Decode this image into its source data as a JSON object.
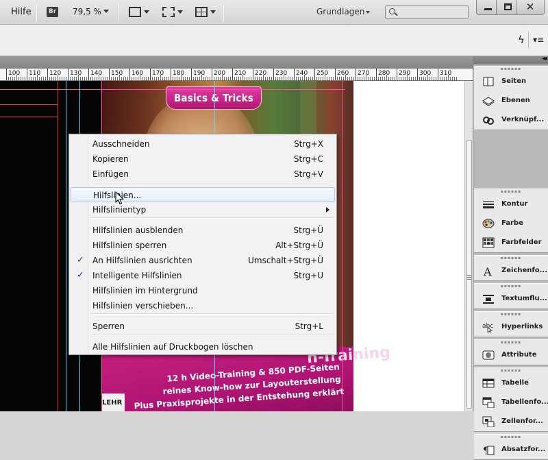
{
  "appbar": {
    "help_menu": "Hilfe",
    "bridge_badge": "Br",
    "zoom_level": "79,5 %",
    "workspace": "Grundlagen",
    "search_placeholder": ""
  },
  "ruler": {
    "labels": [
      "100",
      "110",
      "120",
      "130",
      "140",
      "150",
      "160",
      "170",
      "180",
      "190",
      "200",
      "210",
      "220",
      "230",
      "240",
      "250",
      "260",
      "270",
      "280",
      "290",
      "300",
      "310"
    ]
  },
  "cover": {
    "badge_text": "Basics & Tricks",
    "headline": "n-Training",
    "blurb_line1": "12 h Video-Training & 850 PDF-Seiten",
    "blurb_line2": "reines Know-how zur Layouterstellung",
    "blurb_line3": "Plus Praxisprojekte in der Entstehung erklärt",
    "logo_text": "LEHR"
  },
  "context_menu": {
    "items": [
      {
        "label": "Ausschneiden",
        "shortcut": "Strg+X"
      },
      {
        "label": "Kopieren",
        "shortcut": "Strg+C"
      },
      {
        "label": "Einfügen",
        "shortcut": "Strg+V"
      },
      {
        "label": "Hilfslinien...",
        "shortcut": "",
        "hovered": true
      },
      {
        "label": "Hilfslinientyp",
        "shortcut": "",
        "submenu": true
      },
      {
        "label": "Hilfslinien ausblenden",
        "shortcut": "Strg+Ü"
      },
      {
        "label": "Hilfslinien sperren",
        "shortcut": "Alt+Strg+Ü"
      },
      {
        "label": "An Hilfslinien ausrichten",
        "shortcut": "Umschalt+Strg+Ü",
        "checked": true
      },
      {
        "label": "Intelligente Hilfslinien",
        "shortcut": "Strg+U",
        "checked": true
      },
      {
        "label": "Hilfslinien im Hintergrund",
        "shortcut": ""
      },
      {
        "label": "Hilfslinien verschieben...",
        "shortcut": ""
      },
      {
        "label": "Sperren",
        "shortcut": "Strg+L"
      },
      {
        "label": "Alle Hilfslinien auf Druckbogen löschen",
        "shortcut": ""
      }
    ]
  },
  "dock": {
    "groups": [
      {
        "items": [
          {
            "label": "Seiten",
            "icon": "pages-icon"
          },
          {
            "label": "Ebenen",
            "icon": "layers-icon"
          },
          {
            "label": "Verknüpf...",
            "icon": "links-icon"
          }
        ]
      },
      {
        "items": [
          {
            "label": "Kontur",
            "icon": "stroke-icon"
          },
          {
            "label": "Farbe",
            "icon": "color-palette-icon"
          },
          {
            "label": "Farbfelder",
            "icon": "swatches-icon"
          }
        ]
      },
      {
        "items": [
          {
            "label": "Zeichenfo...",
            "icon": "character-styles-icon"
          }
        ]
      },
      {
        "items": [
          {
            "label": "Textumflu...",
            "icon": "text-wrap-icon"
          }
        ]
      },
      {
        "items": [
          {
            "label": "Hyperlinks",
            "icon": "hyperlinks-icon"
          }
        ]
      },
      {
        "items": [
          {
            "label": "Attribute",
            "icon": "attributes-icon"
          }
        ]
      },
      {
        "items": [
          {
            "label": "Tabelle",
            "icon": "table-icon"
          },
          {
            "label": "Tabellenfo...",
            "icon": "table-styles-icon"
          },
          {
            "label": "Zellenfor...",
            "icon": "cell-styles-icon"
          }
        ]
      },
      {
        "items": [
          {
            "label": "Absatzfor...",
            "icon": "paragraph-styles-icon"
          }
        ]
      }
    ]
  },
  "colors": {
    "menu_check": "#1c3f9c",
    "cover_magenta": "#c8207f",
    "guide_cyan": "#5ad2ff",
    "guide_magenta": "#ff4aa6",
    "guide_red": "#e83232"
  }
}
